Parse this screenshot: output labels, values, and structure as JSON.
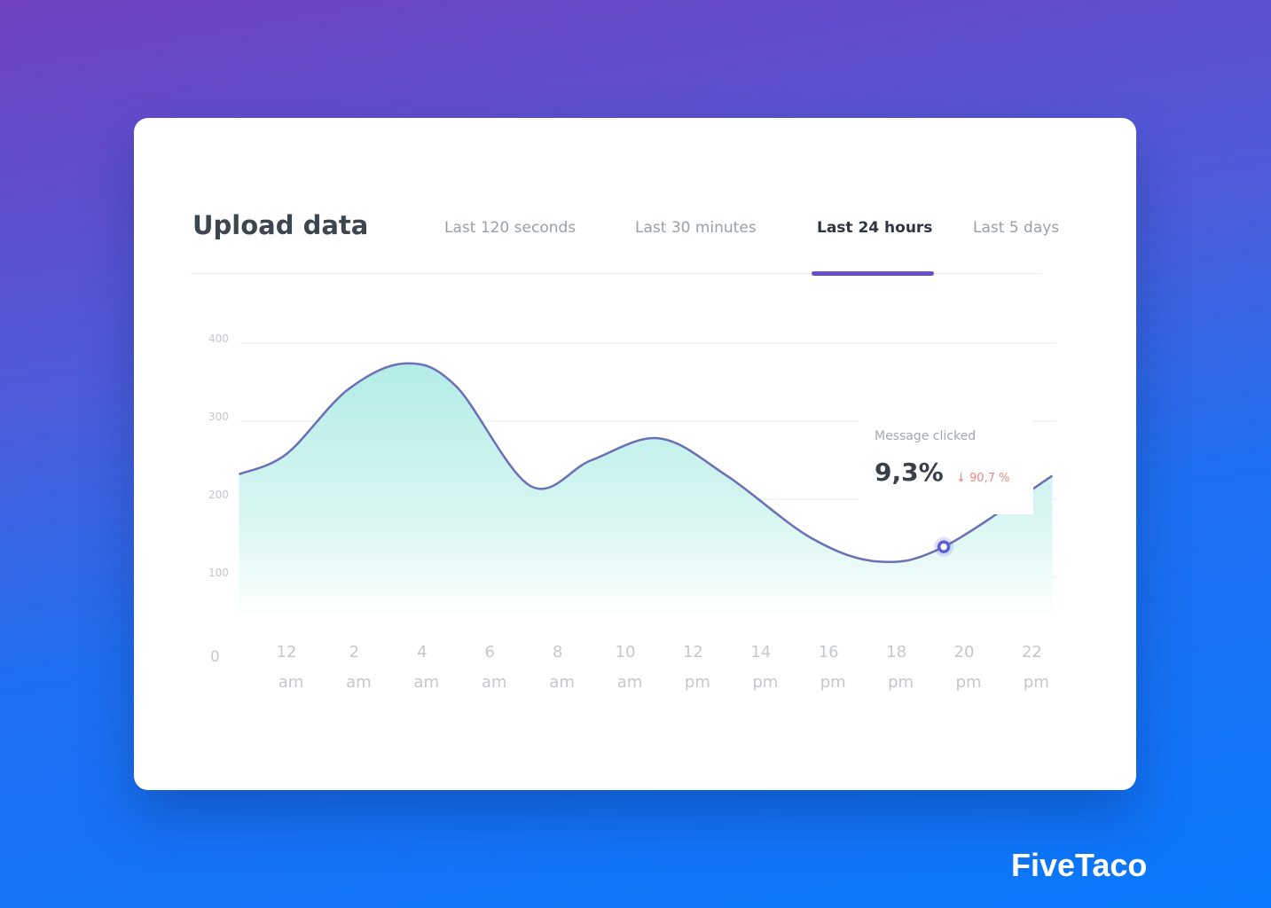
{
  "header": {
    "title": "Upload data"
  },
  "tabs": [
    {
      "label": "Last 120 seconds",
      "active": false
    },
    {
      "label": "Last 30 minutes",
      "active": false
    },
    {
      "label": "Last 24 hours",
      "active": true
    },
    {
      "label": "Last 5 days",
      "active": false
    }
  ],
  "tooltip": {
    "label": "Message clicked",
    "value": "9,3%",
    "delta": "↓ 90,7 %"
  },
  "brand": "FiveTaco",
  "colors": {
    "accent": "#6a4fc8",
    "line": "#6b6fb5",
    "fill": "#b3ece6",
    "marker": "#5a5fd6",
    "delta": "#e48a84"
  },
  "chart_data": {
    "type": "area",
    "title": "",
    "xlabel": "",
    "ylabel": "",
    "ylim": [
      0,
      400
    ],
    "yticks": [
      "0",
      "100",
      "200",
      "300",
      "400"
    ],
    "xticks": [
      {
        "num": "12",
        "ampm": "am"
      },
      {
        "num": "2",
        "ampm": "am"
      },
      {
        "num": "4",
        "ampm": "am"
      },
      {
        "num": "6",
        "ampm": "am"
      },
      {
        "num": "8",
        "ampm": "am"
      },
      {
        "num": "10",
        "ampm": "am"
      },
      {
        "num": "12",
        "ampm": "pm"
      },
      {
        "num": "14",
        "ampm": "pm"
      },
      {
        "num": "16",
        "ampm": "pm"
      },
      {
        "num": "18",
        "ampm": "pm"
      },
      {
        "num": "20",
        "ampm": "pm"
      },
      {
        "num": "22",
        "ampm": "pm"
      }
    ],
    "grid": true,
    "points": [
      [
        -1.4,
        232
      ],
      [
        0,
        258
      ],
      [
        1.8,
        340
      ],
      [
        3.5,
        374
      ],
      [
        5,
        345
      ],
      [
        7.2,
        217
      ],
      [
        9,
        250
      ],
      [
        11,
        278
      ],
      [
        13,
        230
      ],
      [
        15.5,
        150
      ],
      [
        17.5,
        120
      ],
      [
        19.4,
        139
      ],
      [
        22.6,
        230
      ]
    ],
    "highlight": {
      "x": 19.4,
      "y": 139
    }
  }
}
